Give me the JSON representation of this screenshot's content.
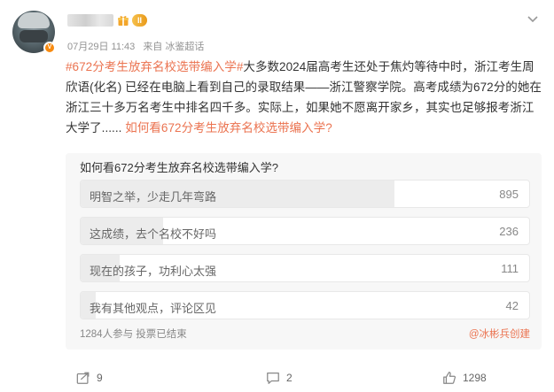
{
  "post": {
    "author": {
      "level_badge": "II",
      "icons": [
        "gift-icon",
        "level-badge",
        "verified-badge-icon"
      ]
    },
    "date": "07月29日 11:43",
    "source": "来自 冰鉴超话",
    "hashtag": "#672分考生放弃名校选带编入学#",
    "body_text": "大多数2024届高考生还处于焦灼等待中时，浙江考生周欣语(化名) 已经在电脑上看到自己的录取结果——浙江警察学院。高考成绩为672分的她在浙江三十多万名考生中排名四千多。实际上，如果她不愿离开家乡，其实也足够报考浙江大学了......",
    "link_text": "如何看672分考生放弃名校选带编入学?"
  },
  "poll": {
    "question": "如何看672分考生放弃名校选带编入学?",
    "options": [
      {
        "label": "明智之举，少走几年弯路",
        "count": 895
      },
      {
        "label": "这成绩，去个名校不好吗",
        "count": 236
      },
      {
        "label": "现在的孩子，功利心太强",
        "count": 111
      },
      {
        "label": "我有其他观点，评论区见",
        "count": 42
      }
    ],
    "footer": "1284人参与 投票已结束",
    "creator": "@冰彬兵创建"
  },
  "actions": {
    "share_count": "9",
    "comment_count": "2",
    "like_count": "1298"
  },
  "colors": {
    "accent": "#eb7350",
    "badge": "#f78a0f",
    "poll_bg": "#f7f7f7"
  }
}
